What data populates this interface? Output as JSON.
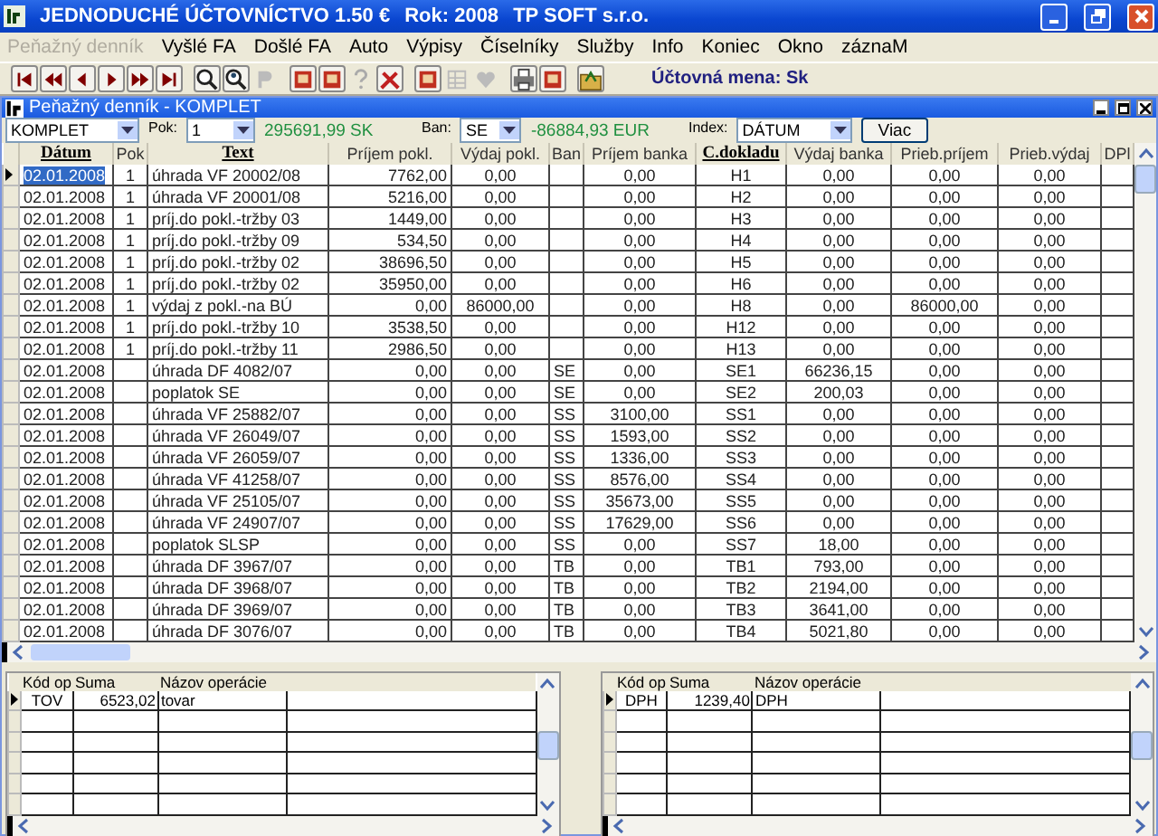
{
  "window": {
    "title": "JEDNODUCHÉ ÚČTOVNÍCTVO 1.50  €",
    "year": "Rok: 2008",
    "company": "TP SOFT s.r.o."
  },
  "menu": [
    {
      "label": "Peňažný denník",
      "disabled": true
    },
    {
      "label": "Vyšlé FA",
      "disabled": false
    },
    {
      "label": "Došlé FA",
      "disabled": false
    },
    {
      "label": "Auto",
      "disabled": false
    },
    {
      "label": "Výpisy",
      "disabled": false
    },
    {
      "label": "Číselníky",
      "disabled": false
    },
    {
      "label": "Služby",
      "disabled": false
    },
    {
      "label": "Info",
      "disabled": false
    },
    {
      "label": "Koniec",
      "disabled": false
    },
    {
      "label": "Okno",
      "disabled": false
    },
    {
      "label": "záznaM",
      "disabled": false
    }
  ],
  "toolbar": {
    "groups": [
      [
        {
          "kind": "first",
          "disabled": false
        },
        {
          "kind": "fastprev",
          "disabled": false
        },
        {
          "kind": "prev",
          "disabled": false
        },
        {
          "kind": "next",
          "disabled": false
        },
        {
          "kind": "fastnext",
          "disabled": false
        },
        {
          "kind": "last",
          "disabled": false
        }
      ],
      [
        {
          "kind": "search",
          "disabled": false
        },
        {
          "kind": "searchuser",
          "disabled": false
        },
        {
          "kind": "letter",
          "disabled": true
        }
      ],
      [
        {
          "kind": "book",
          "disabled": false
        },
        {
          "kind": "book",
          "disabled": false
        },
        {
          "kind": "help",
          "disabled": true
        },
        {
          "kind": "tools",
          "disabled": false
        }
      ],
      [
        {
          "kind": "book",
          "disabled": false
        },
        {
          "kind": "grid",
          "disabled": true
        },
        {
          "kind": "heart",
          "disabled": true
        }
      ],
      [
        {
          "kind": "printer",
          "disabled": false
        },
        {
          "kind": "book",
          "disabled": false
        }
      ],
      [
        {
          "kind": "folder",
          "disabled": false
        }
      ]
    ],
    "currency": "Účtovná mena: Sk"
  },
  "child_window": {
    "title": "Peňažný denník - KOMPLET"
  },
  "filters": {
    "journal": "KOMPLET",
    "pok_label": "Pok:",
    "pok": "1",
    "pok_total": "295691,99 SK",
    "ban_label": "Ban:",
    "ban": "SE",
    "ban_total": "-86884,93 EUR",
    "index_label": "Index:",
    "index": "DÁTUM",
    "more_button": "Viac"
  },
  "table": {
    "columns": [
      {
        "label": "Dátum",
        "indexed": true
      },
      {
        "label": "Pok",
        "indexed": false
      },
      {
        "label": "Text",
        "indexed": true
      },
      {
        "label": "Príjem pokl.",
        "indexed": false
      },
      {
        "label": "Výdaj pokl.",
        "indexed": false
      },
      {
        "label": "Ban",
        "indexed": false
      },
      {
        "label": "Príjem banka",
        "indexed": false
      },
      {
        "label": "C.dokladu",
        "indexed": true
      },
      {
        "label": "Výdaj banka",
        "indexed": false
      },
      {
        "label": "Prieb.príjem",
        "indexed": false
      },
      {
        "label": "Prieb.výdaj",
        "indexed": false
      },
      {
        "label": "DPl",
        "indexed": false
      }
    ],
    "rows": [
      {
        "selected": true,
        "cells": [
          "02.01.2008",
          "1",
          "úhrada VF 20002/08",
          "7762,00",
          "0,00",
          "",
          "0,00",
          "H1",
          "0,00",
          "0,00",
          "0,00"
        ]
      },
      {
        "selected": false,
        "cells": [
          "02.01.2008",
          "1",
          "úhrada VF 20001/08",
          "5216,00",
          "0,00",
          "",
          "0,00",
          "H2",
          "0,00",
          "0,00",
          "0,00"
        ]
      },
      {
        "selected": false,
        "cells": [
          "02.01.2008",
          "1",
          "príj.do pokl.-tržby 03",
          "1449,00",
          "0,00",
          "",
          "0,00",
          "H3",
          "0,00",
          "0,00",
          "0,00"
        ]
      },
      {
        "selected": false,
        "cells": [
          "02.01.2008",
          "1",
          "príj.do pokl.-tržby 09",
          "534,50",
          "0,00",
          "",
          "0,00",
          "H4",
          "0,00",
          "0,00",
          "0,00"
        ]
      },
      {
        "selected": false,
        "cells": [
          "02.01.2008",
          "1",
          "príj.do pokl.-tržby 02",
          "38696,50",
          "0,00",
          "",
          "0,00",
          "H5",
          "0,00",
          "0,00",
          "0,00"
        ]
      },
      {
        "selected": false,
        "cells": [
          "02.01.2008",
          "1",
          "príj.do pokl.-tržby 02",
          "35950,00",
          "0,00",
          "",
          "0,00",
          "H6",
          "0,00",
          "0,00",
          "0,00"
        ]
      },
      {
        "selected": false,
        "cells": [
          "02.01.2008",
          "1",
          "výdaj z pokl.-na BÚ",
          "0,00",
          "86000,00",
          "",
          "0,00",
          "H8",
          "0,00",
          "86000,00",
          "0,00"
        ]
      },
      {
        "selected": false,
        "cells": [
          "02.01.2008",
          "1",
          "príj.do pokl.-tržby 10",
          "3538,50",
          "0,00",
          "",
          "0,00",
          "H12",
          "0,00",
          "0,00",
          "0,00"
        ]
      },
      {
        "selected": false,
        "cells": [
          "02.01.2008",
          "1",
          "príj.do pokl.-tržby 11",
          "2986,50",
          "0,00",
          "",
          "0,00",
          "H13",
          "0,00",
          "0,00",
          "0,00"
        ]
      },
      {
        "selected": false,
        "cells": [
          "02.01.2008",
          "",
          "úhrada DF 4082/07",
          "0,00",
          "0,00",
          "SE",
          "0,00",
          "SE1",
          "66236,15",
          "0,00",
          "0,00"
        ]
      },
      {
        "selected": false,
        "cells": [
          "02.01.2008",
          "",
          "poplatok SE",
          "0,00",
          "0,00",
          "SE",
          "0,00",
          "SE2",
          "200,03",
          "0,00",
          "0,00"
        ]
      },
      {
        "selected": false,
        "cells": [
          "02.01.2008",
          "",
          "úhrada VF 25882/07",
          "0,00",
          "0,00",
          "SS",
          "3100,00",
          "SS1",
          "0,00",
          "0,00",
          "0,00"
        ]
      },
      {
        "selected": false,
        "cells": [
          "02.01.2008",
          "",
          "úhrada VF 26049/07",
          "0,00",
          "0,00",
          "SS",
          "1593,00",
          "SS2",
          "0,00",
          "0,00",
          "0,00"
        ]
      },
      {
        "selected": false,
        "cells": [
          "02.01.2008",
          "",
          "úhrada VF 26059/07",
          "0,00",
          "0,00",
          "SS",
          "1336,00",
          "SS3",
          "0,00",
          "0,00",
          "0,00"
        ]
      },
      {
        "selected": false,
        "cells": [
          "02.01.2008",
          "",
          "úhrada VF 41258/07",
          "0,00",
          "0,00",
          "SS",
          "8576,00",
          "SS4",
          "0,00",
          "0,00",
          "0,00"
        ]
      },
      {
        "selected": false,
        "cells": [
          "02.01.2008",
          "",
          "úhrada VF 25105/07",
          "0,00",
          "0,00",
          "SS",
          "35673,00",
          "SS5",
          "0,00",
          "0,00",
          "0,00"
        ]
      },
      {
        "selected": false,
        "cells": [
          "02.01.2008",
          "",
          "úhrada VF 24907/07",
          "0,00",
          "0,00",
          "SS",
          "17629,00",
          "SS6",
          "0,00",
          "0,00",
          "0,00"
        ]
      },
      {
        "selected": false,
        "cells": [
          "02.01.2008",
          "",
          "poplatok SLSP",
          "0,00",
          "0,00",
          "SS",
          "0,00",
          "SS7",
          "18,00",
          "0,00",
          "0,00"
        ]
      },
      {
        "selected": false,
        "cells": [
          "02.01.2008",
          "",
          "úhrada DF 3967/07",
          "0,00",
          "0,00",
          "TB",
          "0,00",
          "TB1",
          "793,00",
          "0,00",
          "0,00"
        ]
      },
      {
        "selected": false,
        "cells": [
          "02.01.2008",
          "",
          "úhrada DF 3968/07",
          "0,00",
          "0,00",
          "TB",
          "0,00",
          "TB2",
          "2194,00",
          "0,00",
          "0,00"
        ]
      },
      {
        "selected": false,
        "cells": [
          "02.01.2008",
          "",
          "úhrada DF 3969/07",
          "0,00",
          "0,00",
          "TB",
          "0,00",
          "TB3",
          "3641,00",
          "0,00",
          "0,00"
        ]
      },
      {
        "selected": false,
        "cells": [
          "02.01.2008",
          "",
          "úhrada DF 3076/07",
          "0,00",
          "0,00",
          "TB",
          "0,00",
          "TB4",
          "5021,80",
          "0,00",
          "0,00"
        ]
      }
    ]
  },
  "sub_tables": [
    {
      "columns": [
        "Kód op",
        "Suma",
        "Názov operácie"
      ],
      "rows": [
        {
          "selected": true,
          "cells": [
            "TOV",
            "6523,02",
            "tovar"
          ]
        }
      ]
    },
    {
      "columns": [
        "Kód op",
        "Suma",
        "Názov operácie"
      ],
      "rows": [
        {
          "selected": true,
          "cells": [
            "DPH",
            "1239,40",
            "DPH"
          ]
        }
      ]
    }
  ]
}
